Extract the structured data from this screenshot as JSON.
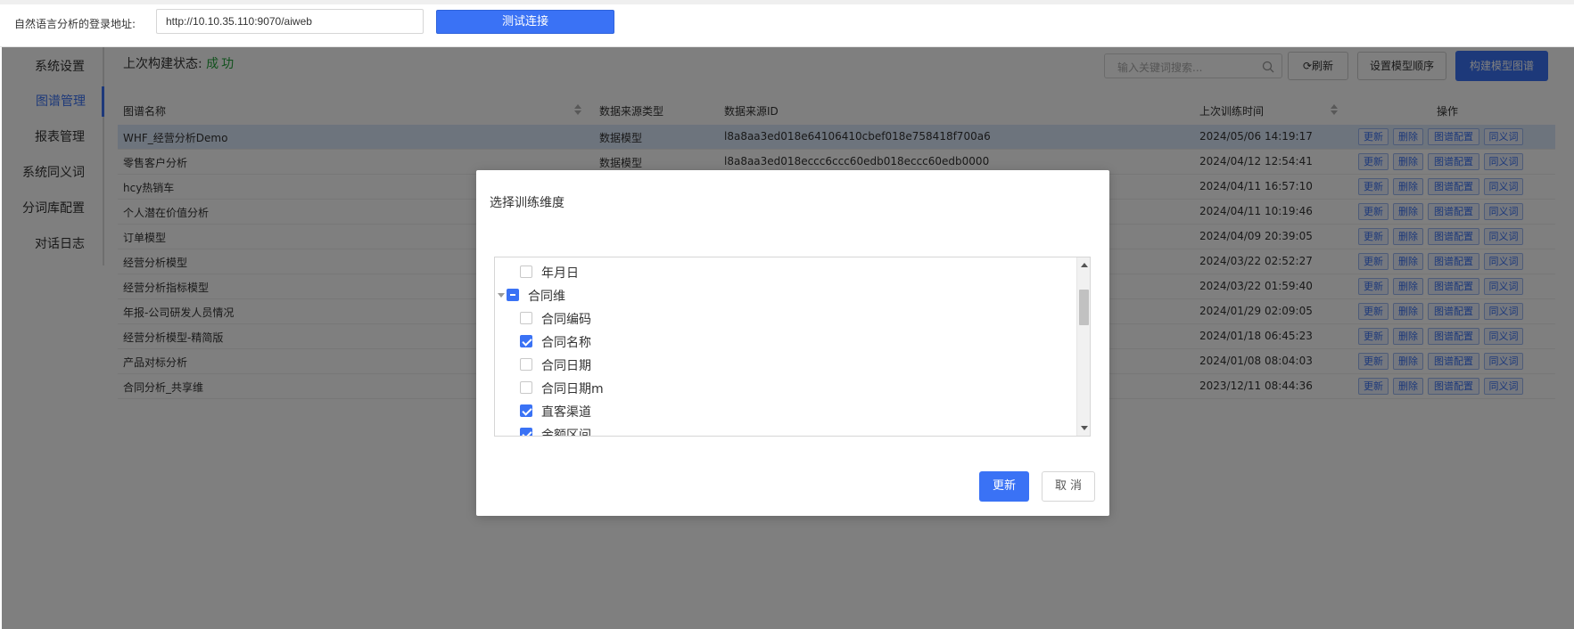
{
  "topbar": {
    "login_label": "自然语言分析的登录地址:",
    "login_url": "http://10.10.35.110:9070/aiweb",
    "test_button": "测试连接"
  },
  "sidebar": {
    "items": [
      {
        "label": "系统设置",
        "active": false
      },
      {
        "label": "图谱管理",
        "active": true
      },
      {
        "label": "报表管理",
        "active": false
      },
      {
        "label": "系统同义词",
        "active": false
      },
      {
        "label": "分词库配置",
        "active": false
      },
      {
        "label": "对话日志",
        "active": false
      }
    ]
  },
  "toolbar": {
    "status_label": "上次构建状态:",
    "status_value": "成功",
    "search_placeholder": "输入关键词搜索...",
    "refresh_label": "刷新",
    "order_label": "设置模型顺序",
    "build_label": "构建模型图谱"
  },
  "table": {
    "headers": [
      "图谱名称",
      "数据来源类型",
      "数据来源ID",
      "上次训练时间",
      "操作"
    ],
    "actions": [
      "更新",
      "删除",
      "图谱配置",
      "同义词"
    ],
    "rows": [
      {
        "name": "WHF_经营分析Demo",
        "type": "数据模型",
        "id": "l8a8aa3ed018e64106410cbef018e758418f700a6",
        "time": "2024/05/06 14:19:17"
      },
      {
        "name": "零售客户分析",
        "type": "数据模型",
        "id": "l8a8aa3ed018eccc6ccc60edb018eccc60edb0000",
        "time": "2024/04/12 12:54:41"
      },
      {
        "name": "hcy热销车",
        "type": "",
        "id": "",
        "time": "2024/04/11 16:57:10"
      },
      {
        "name": "个人潜在价值分析",
        "type": "",
        "id": "",
        "time": "2024/04/11 10:19:46"
      },
      {
        "name": "订单模型",
        "type": "",
        "id": "",
        "time": "2024/04/09 20:39:05"
      },
      {
        "name": "经营分析模型",
        "type": "",
        "id": "",
        "time": "2024/03/22 02:52:27"
      },
      {
        "name": "经营分析指标模型",
        "type": "",
        "id": "",
        "time": "2024/03/22 01:59:40"
      },
      {
        "name": "年报-公司研发人员情况",
        "type": "",
        "id": "",
        "time": "2024/01/29 02:09:05"
      },
      {
        "name": "经营分析模型-精简版",
        "type": "",
        "id": "",
        "time": "2024/01/18 06:45:23"
      },
      {
        "name": "产品对标分析",
        "type": "",
        "id": "",
        "time": "2024/01/08 08:04:03"
      },
      {
        "name": "合同分析_共享维",
        "type": "",
        "id": "",
        "time": "2023/12/11 08:44:36"
      }
    ]
  },
  "dialog": {
    "title": "选择训练维度",
    "tree": [
      {
        "label": "年月日",
        "level": 1,
        "state": "unchecked"
      },
      {
        "label": "合同维",
        "level": 0,
        "state": "partial"
      },
      {
        "label": "合同编码",
        "level": 1,
        "state": "unchecked"
      },
      {
        "label": "合同名称",
        "level": 1,
        "state": "checked"
      },
      {
        "label": "合同日期",
        "level": 1,
        "state": "unchecked"
      },
      {
        "label": "合同日期m",
        "level": 1,
        "state": "unchecked"
      },
      {
        "label": "直客渠道",
        "level": 1,
        "state": "checked"
      },
      {
        "label": "金额区间",
        "level": 1,
        "state": "checked"
      }
    ],
    "update_button": "更新",
    "cancel_button": "取消"
  },
  "colors": {
    "accent": "#3a72f5",
    "success": "#23a33a",
    "overlay": "rgba(0,0,0,0.5)"
  }
}
